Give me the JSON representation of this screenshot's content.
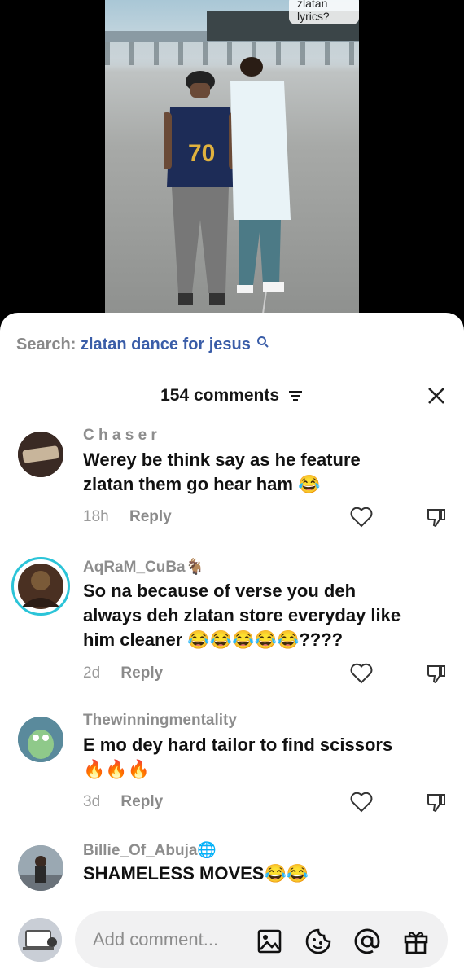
{
  "video": {
    "caption": "zlatan lyrics?",
    "jersey_number": "70"
  },
  "search": {
    "label": "Search:",
    "query": "zlatan dance for jesus"
  },
  "comments_header": {
    "count_label": "154 comments"
  },
  "comments": [
    {
      "username": "C h a s e r",
      "text_lines": [
        "Werey be think say as he feature",
        "zlatan them go hear ham 😂"
      ],
      "time": "18h",
      "reply": "Reply"
    },
    {
      "username": "AqRaM_CuBa🐐",
      "text_lines": [
        "So na because of verse you deh",
        "always deh zlatan store everyday like",
        "him cleaner 😂😂😂😂😂????"
      ],
      "time": "2d",
      "reply": "Reply"
    },
    {
      "username": "Thewinningmentality",
      "text_lines": [
        "E mo dey hard tailor to find scissors",
        "🔥🔥🔥"
      ],
      "time": "3d",
      "reply": "Reply"
    },
    {
      "username": "Billie_Of_Abuja🌐",
      "text_lines": [
        "SHAMELESS MOVES😂😂"
      ],
      "time": "",
      "reply": ""
    }
  ],
  "composer": {
    "placeholder": "Add comment..."
  },
  "icons": {
    "search": "search-icon",
    "filter": "filter-icon",
    "close": "close-icon",
    "heart": "heart-icon",
    "dislike": "dislike-icon",
    "image": "image-icon",
    "emoji": "emoji-icon",
    "mention": "at-icon",
    "gift": "gift-icon"
  },
  "colors": {
    "accent_link": "#3a5da8",
    "story_ring": "#2bc4d8"
  }
}
